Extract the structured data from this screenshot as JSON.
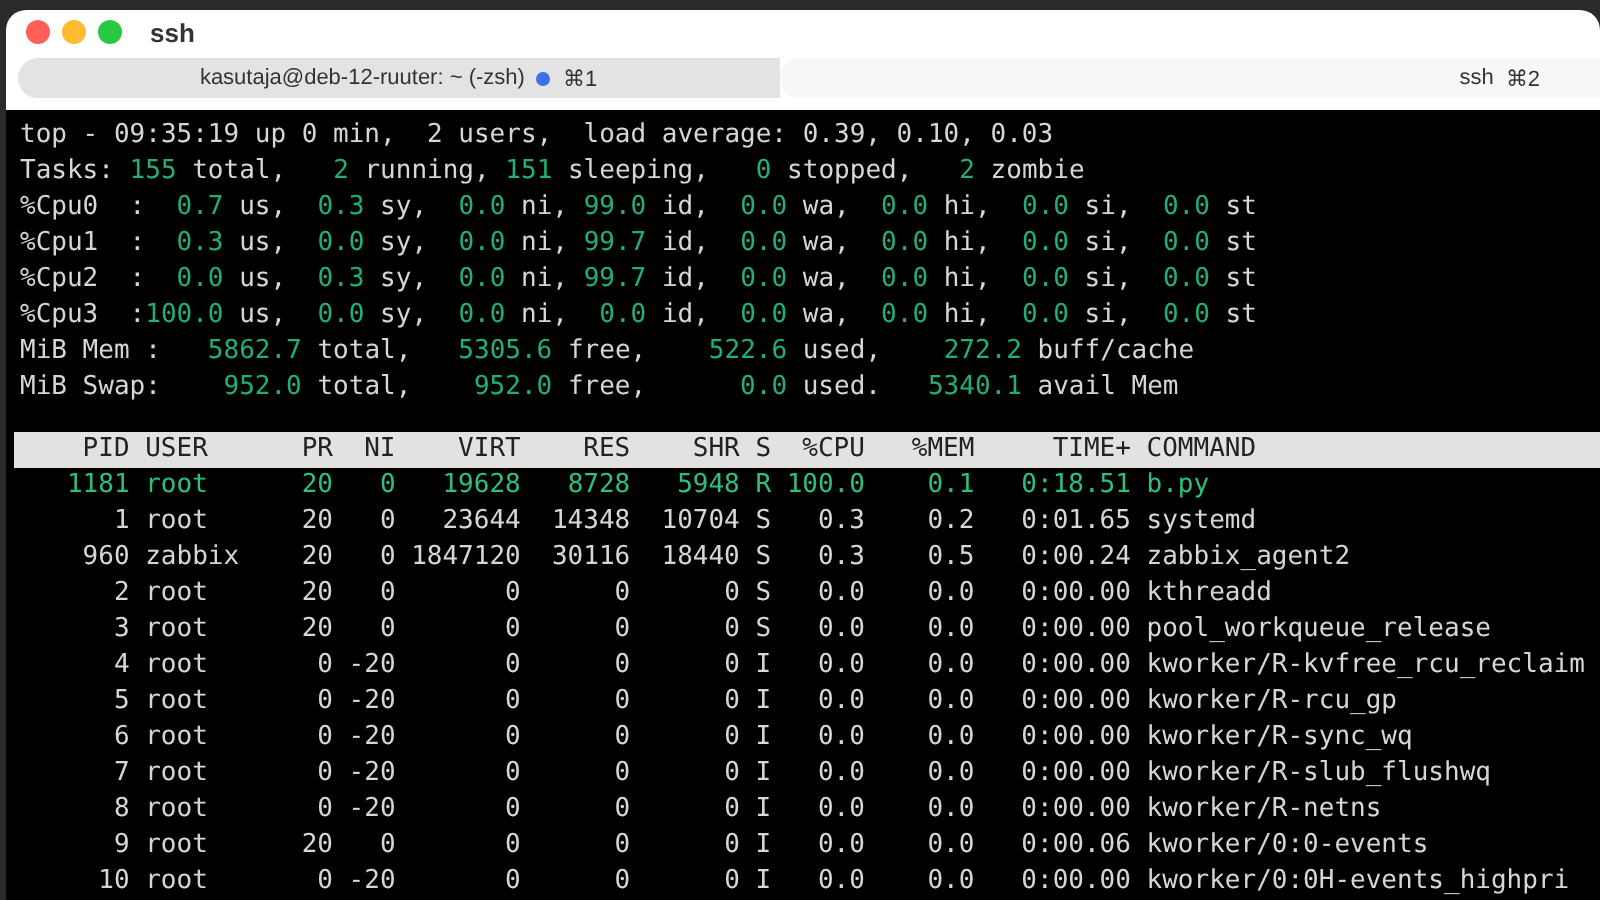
{
  "window": {
    "title": "ssh"
  },
  "tabs": [
    {
      "label": "kasutaja@deb-12-ruuter: ~ (-zsh)",
      "shortcut": "⌘1",
      "activity": true,
      "selected": false
    },
    {
      "label": "ssh",
      "shortcut": "⌘2",
      "activity": false,
      "selected": true
    }
  ],
  "summary": [
    [
      {
        "text": "top - 09:35:19 up 0 min,  2 users,  load average: 0.39, 0.10, 0.03",
        "kind": "label"
      }
    ],
    [
      {
        "text": "Tasks: ",
        "kind": "label"
      },
      {
        "text": "155",
        "kind": "value"
      },
      {
        "text": " total,   ",
        "kind": "label"
      },
      {
        "text": "2",
        "kind": "value"
      },
      {
        "text": " running, ",
        "kind": "label"
      },
      {
        "text": "151",
        "kind": "value"
      },
      {
        "text": " sleeping,   ",
        "kind": "label"
      },
      {
        "text": "0",
        "kind": "value"
      },
      {
        "text": " stopped,   ",
        "kind": "label"
      },
      {
        "text": "2",
        "kind": "value"
      },
      {
        "text": " zombie",
        "kind": "label"
      }
    ],
    [
      {
        "text": "%Cpu0  :  ",
        "kind": "label"
      },
      {
        "text": "0.7",
        "kind": "value"
      },
      {
        "text": " us,  ",
        "kind": "label"
      },
      {
        "text": "0.3",
        "kind": "value"
      },
      {
        "text": " sy,  ",
        "kind": "label"
      },
      {
        "text": "0.0",
        "kind": "value"
      },
      {
        "text": " ni, ",
        "kind": "label"
      },
      {
        "text": "99.0",
        "kind": "value"
      },
      {
        "text": " id,  ",
        "kind": "label"
      },
      {
        "text": "0.0",
        "kind": "value"
      },
      {
        "text": " wa,  ",
        "kind": "label"
      },
      {
        "text": "0.0",
        "kind": "value"
      },
      {
        "text": " hi,  ",
        "kind": "label"
      },
      {
        "text": "0.0",
        "kind": "value"
      },
      {
        "text": " si,  ",
        "kind": "label"
      },
      {
        "text": "0.0",
        "kind": "value"
      },
      {
        "text": " st",
        "kind": "label"
      }
    ],
    [
      {
        "text": "%Cpu1  :  ",
        "kind": "label"
      },
      {
        "text": "0.3",
        "kind": "value"
      },
      {
        "text": " us,  ",
        "kind": "label"
      },
      {
        "text": "0.0",
        "kind": "value"
      },
      {
        "text": " sy,  ",
        "kind": "label"
      },
      {
        "text": "0.0",
        "kind": "value"
      },
      {
        "text": " ni, ",
        "kind": "label"
      },
      {
        "text": "99.7",
        "kind": "value"
      },
      {
        "text": " id,  ",
        "kind": "label"
      },
      {
        "text": "0.0",
        "kind": "value"
      },
      {
        "text": " wa,  ",
        "kind": "label"
      },
      {
        "text": "0.0",
        "kind": "value"
      },
      {
        "text": " hi,  ",
        "kind": "label"
      },
      {
        "text": "0.0",
        "kind": "value"
      },
      {
        "text": " si,  ",
        "kind": "label"
      },
      {
        "text": "0.0",
        "kind": "value"
      },
      {
        "text": " st",
        "kind": "label"
      }
    ],
    [
      {
        "text": "%Cpu2  :  ",
        "kind": "label"
      },
      {
        "text": "0.0",
        "kind": "value"
      },
      {
        "text": " us,  ",
        "kind": "label"
      },
      {
        "text": "0.3",
        "kind": "value"
      },
      {
        "text": " sy,  ",
        "kind": "label"
      },
      {
        "text": "0.0",
        "kind": "value"
      },
      {
        "text": " ni, ",
        "kind": "label"
      },
      {
        "text": "99.7",
        "kind": "value"
      },
      {
        "text": " id,  ",
        "kind": "label"
      },
      {
        "text": "0.0",
        "kind": "value"
      },
      {
        "text": " wa,  ",
        "kind": "label"
      },
      {
        "text": "0.0",
        "kind": "value"
      },
      {
        "text": " hi,  ",
        "kind": "label"
      },
      {
        "text": "0.0",
        "kind": "value"
      },
      {
        "text": " si,  ",
        "kind": "label"
      },
      {
        "text": "0.0",
        "kind": "value"
      },
      {
        "text": " st",
        "kind": "label"
      }
    ],
    [
      {
        "text": "%Cpu3  :",
        "kind": "label"
      },
      {
        "text": "100.0",
        "kind": "value"
      },
      {
        "text": " us,  ",
        "kind": "label"
      },
      {
        "text": "0.0",
        "kind": "value"
      },
      {
        "text": " sy,  ",
        "kind": "label"
      },
      {
        "text": "0.0",
        "kind": "value"
      },
      {
        "text": " ni,  ",
        "kind": "label"
      },
      {
        "text": "0.0",
        "kind": "value"
      },
      {
        "text": " id,  ",
        "kind": "label"
      },
      {
        "text": "0.0",
        "kind": "value"
      },
      {
        "text": " wa,  ",
        "kind": "label"
      },
      {
        "text": "0.0",
        "kind": "value"
      },
      {
        "text": " hi,  ",
        "kind": "label"
      },
      {
        "text": "0.0",
        "kind": "value"
      },
      {
        "text": " si,  ",
        "kind": "label"
      },
      {
        "text": "0.0",
        "kind": "value"
      },
      {
        "text": " st",
        "kind": "label"
      }
    ],
    [
      {
        "text": "MiB Mem :   ",
        "kind": "label"
      },
      {
        "text": "5862.7",
        "kind": "value"
      },
      {
        "text": " total,   ",
        "kind": "label"
      },
      {
        "text": "5305.6",
        "kind": "value"
      },
      {
        "text": " free,    ",
        "kind": "label"
      },
      {
        "text": "522.6",
        "kind": "value"
      },
      {
        "text": " used,    ",
        "kind": "label"
      },
      {
        "text": "272.2",
        "kind": "value"
      },
      {
        "text": " buff/cache",
        "kind": "label"
      }
    ],
    [
      {
        "text": "MiB Swap:    ",
        "kind": "label"
      },
      {
        "text": "952.0",
        "kind": "value"
      },
      {
        "text": " total,    ",
        "kind": "label"
      },
      {
        "text": "952.0",
        "kind": "value"
      },
      {
        "text": " free,      ",
        "kind": "label"
      },
      {
        "text": "0.0",
        "kind": "value"
      },
      {
        "text": " used.   ",
        "kind": "label"
      },
      {
        "text": "5340.1",
        "kind": "value"
      },
      {
        "text": " avail Mem",
        "kind": "label"
      }
    ]
  ],
  "table": {
    "columns": [
      "PID",
      "USER",
      "PR",
      "NI",
      "VIRT",
      "RES",
      "SHR",
      "S",
      "%CPU",
      "%MEM",
      "TIME+",
      "COMMAND"
    ],
    "rows": [
      {
        "cells": [
          "1181",
          "root",
          "20",
          "0",
          "19628",
          "8728",
          "5948",
          "R",
          "100.0",
          "0.1",
          "0:18.51",
          "b.py"
        ],
        "highlighted": true
      },
      {
        "cells": [
          "1",
          "root",
          "20",
          "0",
          "23644",
          "14348",
          "10704",
          "S",
          "0.3",
          "0.2",
          "0:01.65",
          "systemd"
        ],
        "highlighted": false
      },
      {
        "cells": [
          "960",
          "zabbix",
          "20",
          "0",
          "1847120",
          "30116",
          "18440",
          "S",
          "0.3",
          "0.5",
          "0:00.24",
          "zabbix_agent2"
        ],
        "highlighted": false
      },
      {
        "cells": [
          "2",
          "root",
          "20",
          "0",
          "0",
          "0",
          "0",
          "S",
          "0.0",
          "0.0",
          "0:00.00",
          "kthreadd"
        ],
        "highlighted": false
      },
      {
        "cells": [
          "3",
          "root",
          "20",
          "0",
          "0",
          "0",
          "0",
          "S",
          "0.0",
          "0.0",
          "0:00.00",
          "pool_workqueue_release"
        ],
        "highlighted": false
      },
      {
        "cells": [
          "4",
          "root",
          "0",
          "-20",
          "0",
          "0",
          "0",
          "I",
          "0.0",
          "0.0",
          "0:00.00",
          "kworker/R-kvfree_rcu_reclaim"
        ],
        "highlighted": false
      },
      {
        "cells": [
          "5",
          "root",
          "0",
          "-20",
          "0",
          "0",
          "0",
          "I",
          "0.0",
          "0.0",
          "0:00.00",
          "kworker/R-rcu_gp"
        ],
        "highlighted": false
      },
      {
        "cells": [
          "6",
          "root",
          "0",
          "-20",
          "0",
          "0",
          "0",
          "I",
          "0.0",
          "0.0",
          "0:00.00",
          "kworker/R-sync_wq"
        ],
        "highlighted": false
      },
      {
        "cells": [
          "7",
          "root",
          "0",
          "-20",
          "0",
          "0",
          "0",
          "I",
          "0.0",
          "0.0",
          "0:00.00",
          "kworker/R-slub_flushwq"
        ],
        "highlighted": false
      },
      {
        "cells": [
          "8",
          "root",
          "0",
          "-20",
          "0",
          "0",
          "0",
          "I",
          "0.0",
          "0.0",
          "0:00.00",
          "kworker/R-netns"
        ],
        "highlighted": false
      },
      {
        "cells": [
          "9",
          "root",
          "20",
          "0",
          "0",
          "0",
          "0",
          "I",
          "0.0",
          "0.0",
          "0:00.06",
          "kworker/0:0-events"
        ],
        "highlighted": false
      },
      {
        "cells": [
          "10",
          "root",
          "0",
          "-20",
          "0",
          "0",
          "0",
          "I",
          "0.0",
          "0.0",
          "0:00.00",
          "kworker/0:0H-events_highpri"
        ],
        "highlighted": false
      }
    ]
  }
}
